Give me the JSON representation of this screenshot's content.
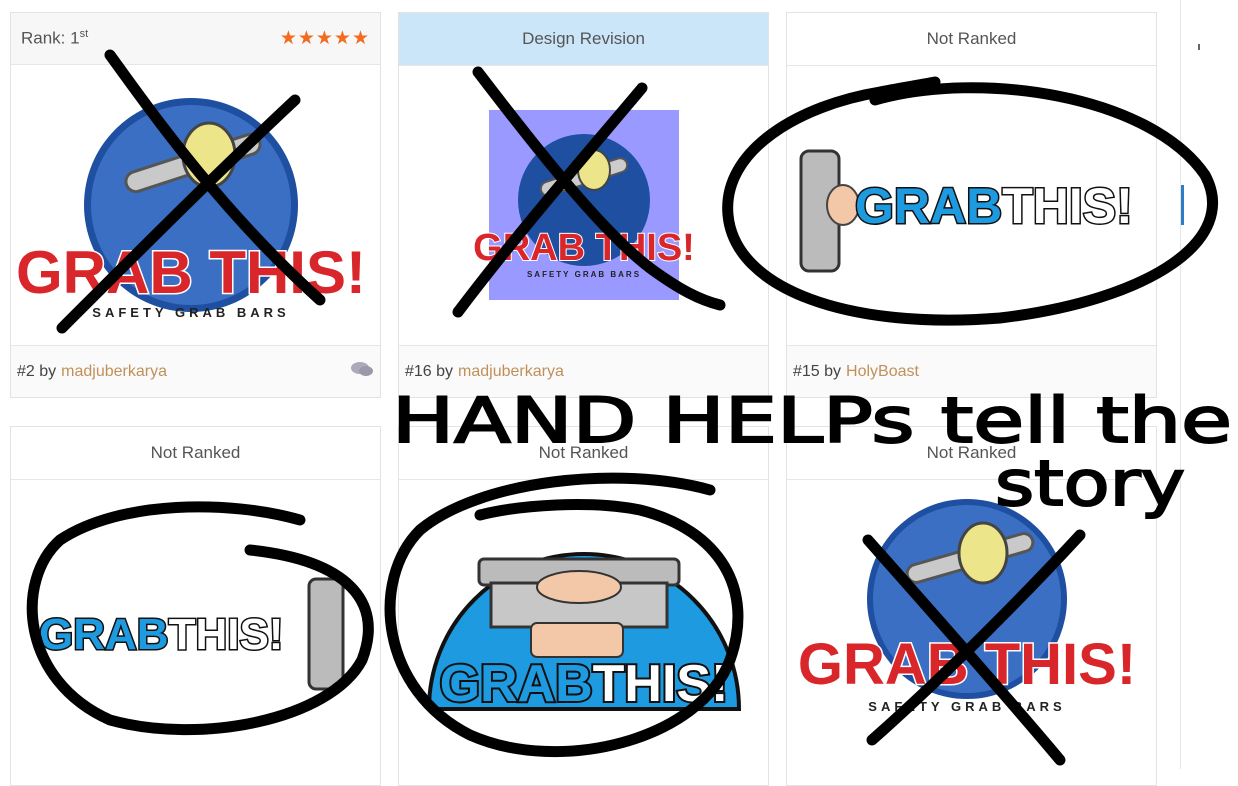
{
  "cards": [
    {
      "header": "Rank: 1",
      "header_sup": "st",
      "stars": "★★★★★",
      "logo_title": "GRAB THIS!",
      "logo_subtitle": "SAFETY GRAB BARS",
      "entry": "#2 by",
      "author": "madjuberkarya",
      "comment_icon": "comment-icon"
    },
    {
      "header": "Design Revision",
      "logo_title": "GRAB THIS!",
      "logo_subtitle": "SAFETY GRAB BARS",
      "entry": "#16 by",
      "author": "madjuberkarya"
    },
    {
      "header": "Not Ranked",
      "logo_word_a": "GRAB",
      "logo_word_b": "THIS!",
      "entry": "#15 by",
      "author": "HolyBoast"
    },
    {
      "header": "Not Ranked",
      "logo_word_a": "GRAB",
      "logo_word_b": "THIS!"
    },
    {
      "header": "Not Ranked",
      "logo_word_a": "GRAB",
      "logo_word_b": "THIS!"
    },
    {
      "header": "Not Ranked",
      "logo_title": "GRAB THIS!",
      "logo_subtitle": "SAFETY GRAB BARS"
    }
  ],
  "annotation": {
    "line1": "HAND HELPs tell the",
    "line2": "story"
  },
  "colors": {
    "accent_blue": "#1e9be0",
    "logo_red": "#d8262b",
    "star_orange": "#f36b21",
    "ink": "#000000",
    "revision_bg": "#cce6f9"
  }
}
